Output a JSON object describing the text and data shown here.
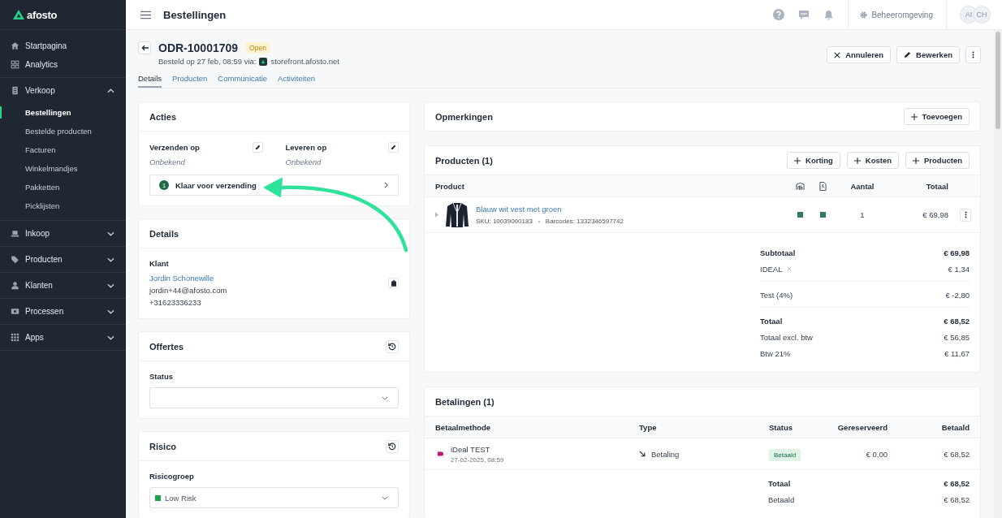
{
  "sidebar": {
    "logo": "afosto",
    "items": [
      {
        "label": "Startpagina",
        "kind": "link",
        "selected": false
      },
      {
        "label": "Analytics",
        "kind": "link",
        "selected": false
      },
      {
        "label": "Verkoop",
        "kind": "group",
        "expanded": true,
        "children": [
          {
            "label": "Bestellingen",
            "selected": true
          },
          {
            "label": "Bestelde producten",
            "selected": false
          },
          {
            "label": "Facturen",
            "selected": false
          },
          {
            "label": "Winkelmandjes",
            "selected": false
          },
          {
            "label": "Pakketten",
            "selected": false
          },
          {
            "label": "Picklijsten",
            "selected": false
          }
        ]
      },
      {
        "label": "Inkoop",
        "kind": "group",
        "expanded": false
      },
      {
        "label": "Producten",
        "kind": "group",
        "expanded": false
      },
      {
        "label": "Klanten",
        "kind": "group",
        "expanded": false
      },
      {
        "label": "Processen",
        "kind": "group",
        "expanded": false
      },
      {
        "label": "Apps",
        "kind": "group",
        "expanded": false
      }
    ]
  },
  "topbar": {
    "title": "Bestellingen",
    "environment": "Beheeromgeving",
    "avatars": [
      "AI",
      "CH"
    ]
  },
  "order": {
    "number": "ODR-10001709",
    "status": "Open",
    "meta": "Besteld op 27 feb, 08:59 via:",
    "source": "storefront.afosto.net",
    "actions": [
      "Annuleren",
      "Bewerken"
    ]
  },
  "tabs": [
    {
      "label": "Details",
      "selected": true
    },
    {
      "label": "Producten",
      "selected": false
    },
    {
      "label": "Communicatie",
      "selected": false
    },
    {
      "label": "Activiteiten",
      "selected": false
    }
  ],
  "acties": {
    "title": "Acties",
    "fields": [
      {
        "label": "Verzenden op",
        "value": "Onbekend"
      },
      {
        "label": "Leveren op",
        "value": "Onbekend"
      }
    ],
    "step": {
      "count": "1",
      "label": "Klaar voor verzending"
    }
  },
  "details": {
    "title": "Details",
    "section": "Klant",
    "name": "Jordin Schonewille",
    "email": "jordin+44@afosto.com",
    "phone": "+31623336233"
  },
  "offertes": {
    "title": "Offertes",
    "field_label": "Status"
  },
  "risico": {
    "title": "Risico",
    "field_label": "Risicogroep",
    "value": "Low Risk"
  },
  "opmerkingen": {
    "title": "Opmerkingen",
    "button": "Toevoegen"
  },
  "producten": {
    "title": "Producten (1)",
    "buttons": [
      "Korting",
      "Kosten",
      "Producten"
    ],
    "columns": [
      "Product",
      "Aantal",
      "Totaal"
    ],
    "rows": [
      {
        "name": "Blauw wit vest met groen",
        "sku": "SKU: 10039000183",
        "barcodes": "Barcodes: 1332346597742",
        "in_stock": true,
        "document_ready": true,
        "quantity": "1",
        "total": "€ 69,98"
      }
    ],
    "summary": [
      {
        "label": "Subtotaal",
        "value": "€ 69,98",
        "kind": "bold",
        "divider_above": false
      },
      {
        "label": "IDEAL",
        "value": "€ 1,34",
        "kind": "removable",
        "divider_above": false
      },
      {
        "label": "Test (4%)",
        "value": "€ -2,80",
        "kind": "plain",
        "divider_above": true
      },
      {
        "label": "Totaal",
        "value": "€ 68,52",
        "kind": "bold",
        "divider_above": true
      },
      {
        "label": "Totaal excl. btw",
        "value": "€ 56,85",
        "kind": "plain",
        "divider_above": false
      },
      {
        "label": "Btw 21%",
        "value": "€ 11,67",
        "kind": "plain",
        "divider_above": false
      }
    ]
  },
  "betalingen": {
    "title": "Betalingen (1)",
    "columns": [
      "Betaalmethode",
      "Type",
      "Status",
      "Gereserveerd",
      "Betaald"
    ],
    "rows": [
      {
        "method": "iDeal TEST",
        "date": "27-02-2025, 08:59",
        "type": "Betaling",
        "status": "Betaald",
        "reserved": "€ 0,00",
        "paid": "€ 68,52"
      }
    ],
    "totals": [
      {
        "label": "Totaal",
        "value": "€ 68,52",
        "kind": "bold"
      },
      {
        "label": "Betaald",
        "value": "€ 68,52",
        "kind": "plain"
      }
    ]
  }
}
